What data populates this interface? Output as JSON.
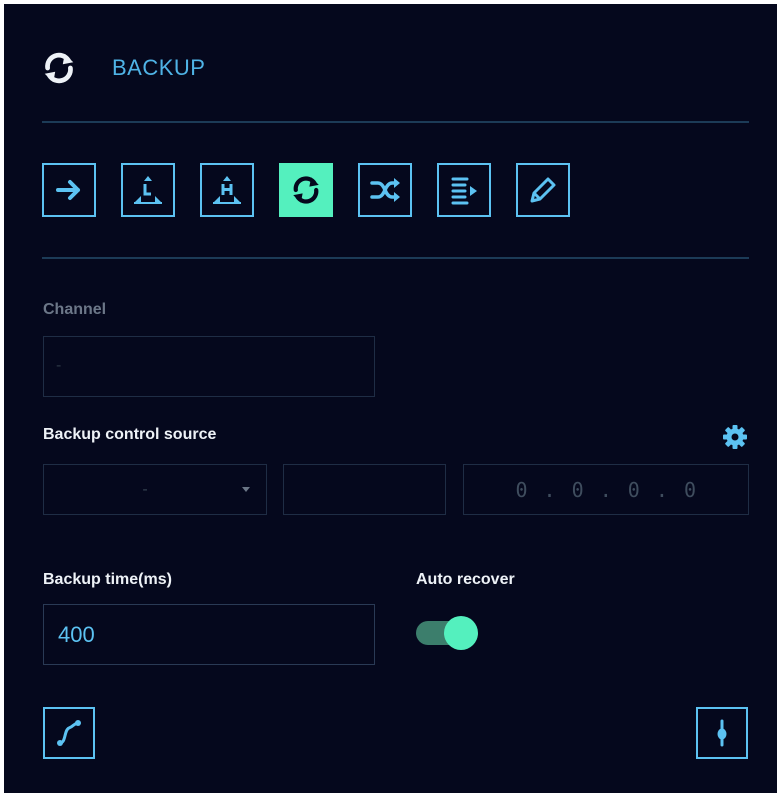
{
  "header": {
    "title": "BACKUP",
    "icon": "sync-icon"
  },
  "modes": [
    {
      "icon": "arrow-right-icon",
      "active": false
    },
    {
      "icon": "pyramid-low-icon",
      "active": false
    },
    {
      "icon": "pyramid-high-icon",
      "active": false
    },
    {
      "icon": "sync-icon",
      "active": true
    },
    {
      "icon": "shuffle-icon",
      "active": false
    },
    {
      "icon": "list-play-icon",
      "active": false
    },
    {
      "icon": "pencil-icon",
      "active": false
    }
  ],
  "channel": {
    "label": "Channel",
    "value": "-"
  },
  "backup_control_source": {
    "label": "Backup control source",
    "select_value": "-",
    "middle_value": "",
    "ip_value": "0 . 0 . 0 . 0"
  },
  "backup_time": {
    "label": "Backup time(ms)",
    "value": "400"
  },
  "auto_recover": {
    "label": "Auto recover",
    "enabled": true
  },
  "colors": {
    "background": "#05081d",
    "accent_cyan": "#5cc2f2",
    "accent_green": "#54f0be",
    "title_blue": "#4fb3e6"
  }
}
